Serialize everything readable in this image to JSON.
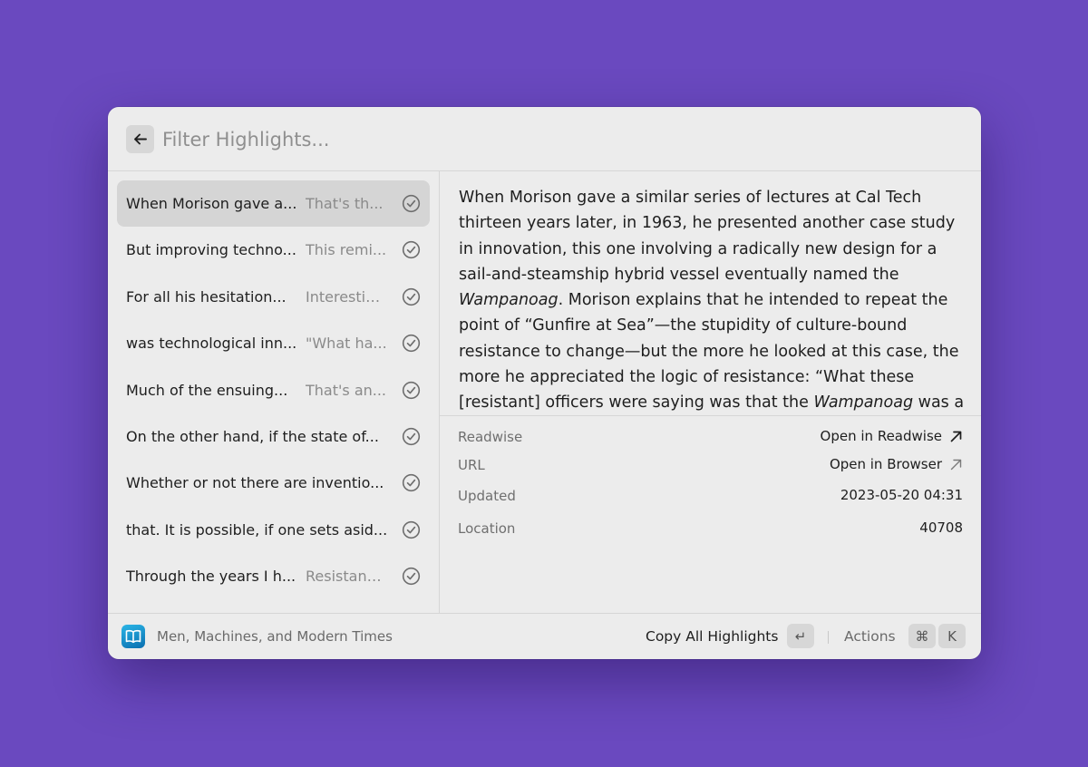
{
  "search": {
    "placeholder": "Filter Highlights...",
    "value": ""
  },
  "highlights": [
    {
      "text": "When Morison gave a...",
      "note": "That's th...",
      "selected": true
    },
    {
      "text": "But improving techno...",
      "note": "This remi...",
      "selected": false
    },
    {
      "text": "For all his hesitation...",
      "note": "Interestin...",
      "selected": false
    },
    {
      "text": "was technological inn...",
      "note": "\"What ha...",
      "selected": false
    },
    {
      "text": "Much of the ensuing...",
      "note": "That's an...",
      "selected": false
    },
    {
      "text": "On the other hand, if the state of...",
      "note": "",
      "selected": false
    },
    {
      "text": "Whether or not there are inventio...",
      "note": "",
      "selected": false
    },
    {
      "text": "that. It is possible, if one sets asid...",
      "note": "",
      "selected": false
    },
    {
      "text": "Through the years I h...",
      "note": "Resistanc...",
      "selected": false
    }
  ],
  "detail": {
    "text_parts": [
      {
        "text": "When Morison gave a similar series of lectures at Cal Tech thirteen years later, in 1963, he presented another case study in innovation, this one involving a radically new design for a sail-and-steamship hybrid vessel eventually named the ",
        "italic": false
      },
      {
        "text": "Wampanoag",
        "italic": true
      },
      {
        "text": ". Morison explains that he intended to repeat the point of “Gunfire at Sea”—the stupidity of culture-bound resistance to change—but the more he looked at this case, the more he appreciated the logic of resistance: “What these [resistant] officers were saying was that the ",
        "italic": false
      },
      {
        "text": "Wampanoag",
        "italic": true
      },
      {
        "text": " was a",
        "italic": false
      }
    ],
    "meta": {
      "readwise_label": "Readwise",
      "readwise_value": "Open in Readwise",
      "url_label": "URL",
      "url_value": "Open in Browser",
      "updated_label": "Updated",
      "updated_value": "2023-05-20 04:31",
      "location_label": "Location",
      "location_value": "40708"
    }
  },
  "footer": {
    "book_title": "Men, Machines, and Modern Times",
    "primary_action": "Copy All Highlights",
    "primary_key": "↵",
    "actions_label": "Actions",
    "actions_keys": [
      "⌘",
      "K"
    ]
  },
  "colors": {
    "background": "#6a49bf",
    "window": "#ececec",
    "selected_row": "#d5d5d5"
  }
}
